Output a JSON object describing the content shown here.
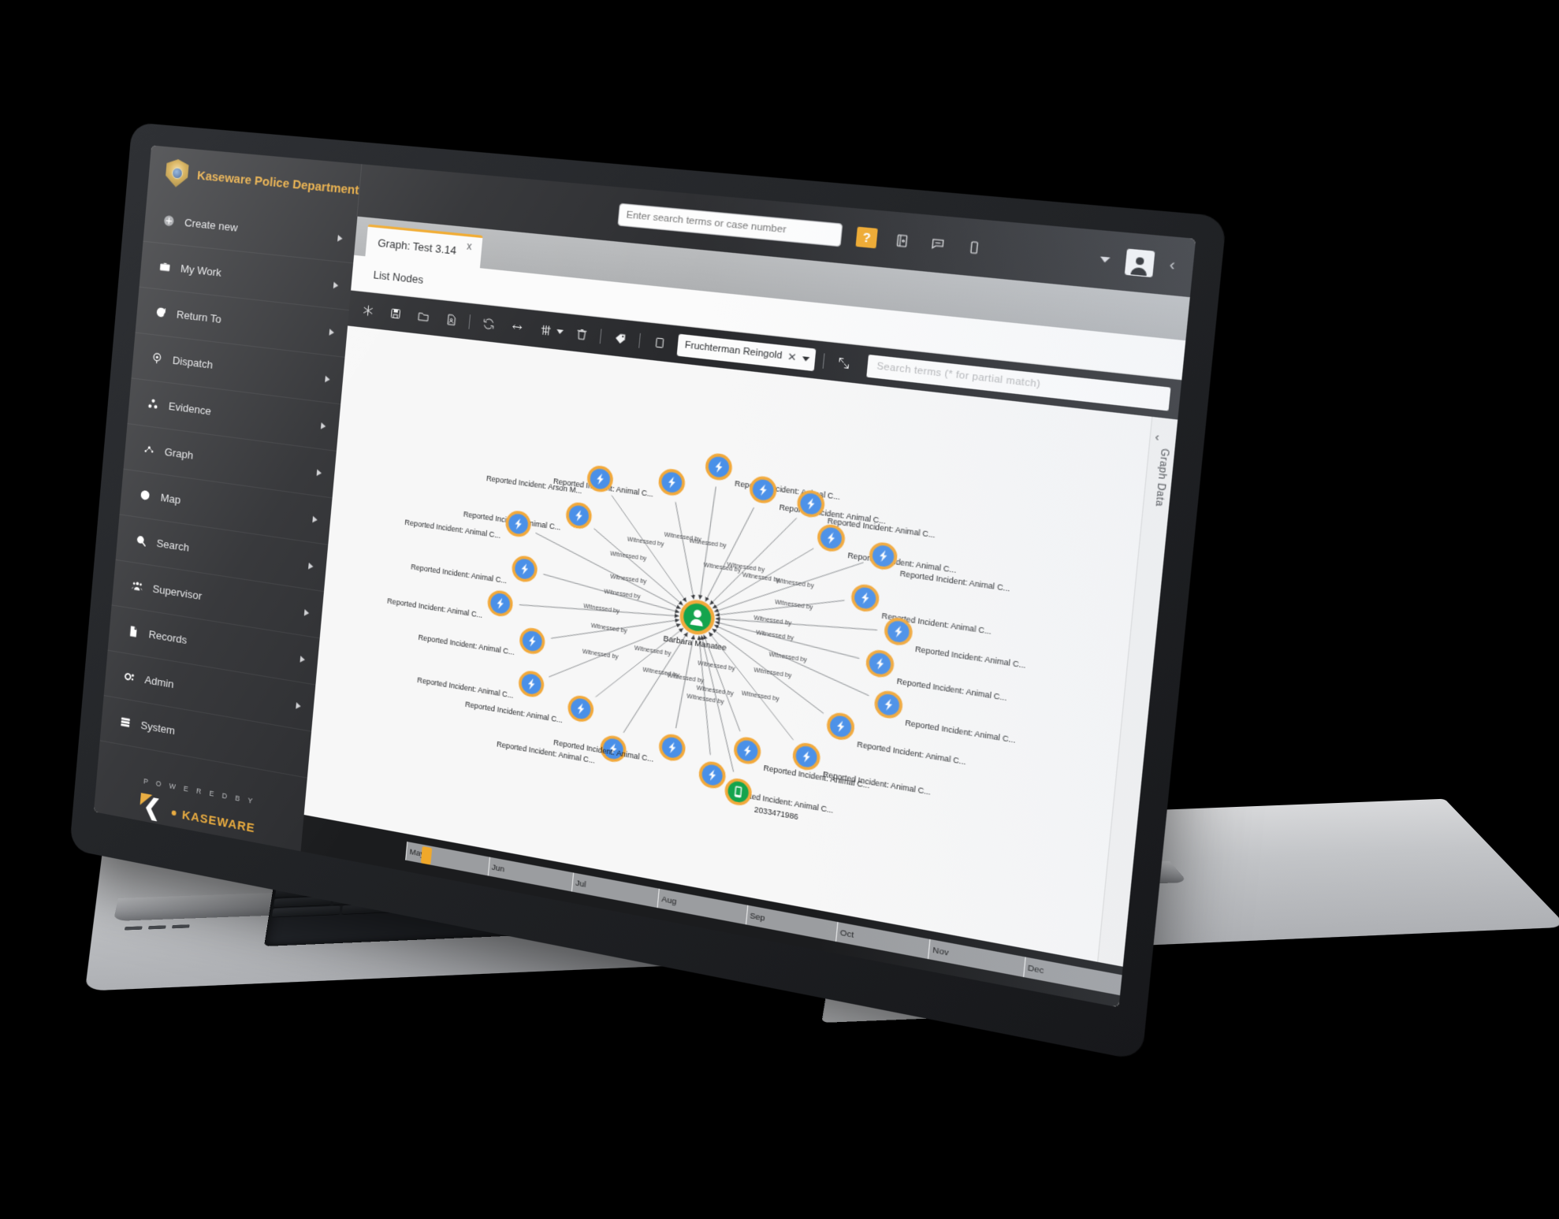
{
  "app": {
    "brand_name": "Kaseware Police Department",
    "badge_icon": "police-badge-icon"
  },
  "topbar": {
    "search_placeholder": "Enter search terms or case number",
    "search_value": "",
    "help_label": "?",
    "icons": [
      {
        "name": "notebook-icon",
        "glyph": "notebook"
      },
      {
        "name": "chat-icon",
        "glyph": "chat"
      },
      {
        "name": "device-icon",
        "glyph": "device"
      }
    ],
    "user_menu_caret": "caret-down-icon",
    "avatar": "user-avatar",
    "collapse": "‹"
  },
  "sidebar": {
    "items": [
      {
        "label": "Create new",
        "icon": "plus-circle-icon",
        "arrow": true
      },
      {
        "label": "My Work",
        "icon": "briefcase-icon",
        "arrow": true
      },
      {
        "label": "Return To",
        "icon": "refresh-icon",
        "arrow": true
      },
      {
        "label": "Dispatch",
        "icon": "dispatch-icon",
        "arrow": true
      },
      {
        "label": "Evidence",
        "icon": "evidence-icon",
        "arrow": true
      },
      {
        "label": "Graph",
        "icon": "graph-icon",
        "arrow": true
      },
      {
        "label": "Map",
        "icon": "globe-icon",
        "arrow": true
      },
      {
        "label": "Search",
        "icon": "search-icon",
        "arrow": true
      },
      {
        "label": "Supervisor",
        "icon": "supervisor-icon",
        "arrow": true
      },
      {
        "label": "Records",
        "icon": "document-icon",
        "arrow": true
      },
      {
        "label": "Admin",
        "icon": "gear-icon",
        "arrow": true
      },
      {
        "label": "System",
        "icon": "server-icon",
        "arrow": false
      }
    ],
    "footer": {
      "powered_by": "P O W E R E D   B Y",
      "logo_word": "KASEWARE"
    }
  },
  "main": {
    "tab": {
      "label": "Graph: Test 3.14",
      "close": "x"
    },
    "subbar": {
      "label": "List Nodes"
    },
    "graph_toolbar": {
      "buttons": [
        {
          "name": "new-graph-button",
          "glyph": "asterisk"
        },
        {
          "name": "save-button",
          "glyph": "save"
        },
        {
          "name": "open-folder-button",
          "glyph": "folder"
        },
        {
          "name": "export-file-button",
          "glyph": "file"
        },
        {
          "name": "refresh-button",
          "glyph": "refresh"
        },
        {
          "name": "expand-button",
          "glyph": "arrows-h"
        },
        {
          "name": "filter-button",
          "glyph": "sliders"
        },
        {
          "name": "delete-button",
          "glyph": "trash"
        },
        {
          "name": "tag-button",
          "glyph": "tag"
        },
        {
          "name": "select-box-button",
          "glyph": "square"
        },
        {
          "name": "fullscreen-button",
          "glyph": "shrink"
        }
      ],
      "layout_select": {
        "value": "Fruchterman Reingold",
        "clear": "✕"
      },
      "search_placeholder": "Search terms (* for partial match)",
      "search_value": ""
    },
    "right_rail": {
      "label": "Graph Data",
      "collapse": "‹"
    },
    "timeline": {
      "months": [
        "May",
        "Jun",
        "Jul",
        "Aug",
        "Sep",
        "Oct",
        "Nov",
        "Dec"
      ],
      "handle_position_pct": 16
    }
  },
  "chart_data": {
    "type": "graph",
    "title": "Graph: Test 3.14",
    "layout": "Fruchterman Reingold",
    "center_node": {
      "label": "Barbara Manatee",
      "type": "person",
      "color": "#14a44d",
      "ring": "#f2a93b"
    },
    "edge_label": "Witnessed by",
    "nodes": [
      {
        "label": "Reported Incident: Animal C...",
        "type": "incident",
        "angle": 258,
        "radius": 160
      },
      {
        "label": "Reported Incident: Animal C...",
        "type": "incident",
        "angle": 272,
        "radius": 182
      },
      {
        "label": "Reported Incident: Animal C...",
        "type": "incident",
        "angle": 286,
        "radius": 168
      },
      {
        "label": "Reported Incident: Arson M...",
        "type": "incident",
        "angle": 237,
        "radius": 178
      },
      {
        "label": "Reported Incident: Animal C...",
        "type": "incident",
        "angle": 300,
        "radius": 176
      },
      {
        "label": "Reported Incident: Animal C...",
        "type": "incident",
        "angle": 222,
        "radius": 152
      },
      {
        "label": "Reported Incident: Animal C...",
        "type": "incident",
        "angle": 313,
        "radius": 158
      },
      {
        "label": "Reported Incident: Animal C...",
        "type": "incident",
        "angle": 206,
        "radius": 186
      },
      {
        "label": "Reported Incident: Animal C...",
        "type": "incident",
        "angle": 326,
        "radius": 184
      },
      {
        "label": "Reported Incident: Animal C...",
        "type": "incident",
        "angle": 190,
        "radius": 160
      },
      {
        "label": "Reported Incident: Animal C...",
        "type": "incident",
        "angle": 340,
        "radius": 150
      },
      {
        "label": "Reported Incident: Animal C...",
        "type": "incident",
        "angle": 174,
        "radius": 178
      },
      {
        "label": "Reported Incident: Animal C...",
        "type": "incident",
        "angle": 354,
        "radius": 172
      },
      {
        "label": "Reported Incident: Animal C...",
        "type": "incident",
        "angle": 158,
        "radius": 156
      },
      {
        "label": "Reported Incident: Animal C...",
        "type": "incident",
        "angle": 8,
        "radius": 160
      },
      {
        "label": "Reported Incident: Animal C...",
        "type": "incident",
        "angle": 142,
        "radius": 180
      },
      {
        "label": "Reported Incident: Animal C...",
        "type": "incident",
        "angle": 22,
        "radius": 182
      },
      {
        "label": "Reported Incident: Animal C...",
        "type": "incident",
        "angle": 126,
        "radius": 162
      },
      {
        "label": "Reported Incident: Animal C...",
        "type": "incident",
        "angle": 38,
        "radius": 166
      },
      {
        "label": "Reported Incident: Animal C...",
        "type": "incident",
        "angle": 110,
        "radius": 184
      },
      {
        "label": "Reported Incident: Animal C...",
        "type": "incident",
        "angle": 54,
        "radius": 178
      },
      {
        "label": "Reported Incident: Animal C...",
        "type": "incident",
        "angle": 94,
        "radius": 160
      },
      {
        "label": "Reported Incident: Animal C...",
        "type": "incident",
        "angle": 70,
        "radius": 158
      },
      {
        "label": "Reported Incident: Animal C...",
        "type": "incident",
        "angle": 82,
        "radius": 186
      },
      {
        "label": "2033471986",
        "type": "phone",
        "angle": 76,
        "radius": 205,
        "color": "#14a44d"
      }
    ]
  }
}
